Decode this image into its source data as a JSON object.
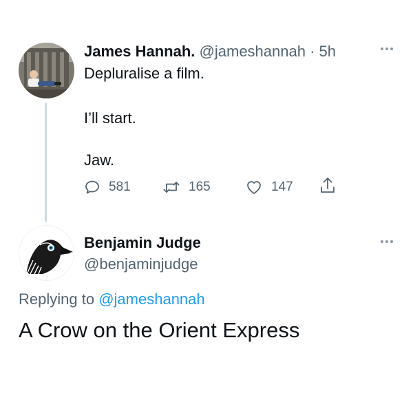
{
  "tweet": {
    "author_name": "James Hannah.",
    "author_handle": "@jameshannah",
    "separator": "·",
    "time": "5h",
    "lines": [
      "Depluralise a film.",
      "I’ll start.",
      "Jaw."
    ],
    "actions": {
      "replies": "581",
      "retweets": "165",
      "likes": "147"
    },
    "avatar_icon": "user-photo-avatar"
  },
  "reply": {
    "author_name": "Benjamin Judge",
    "author_handle": "@benjaminjudge",
    "replying_prefix": "Replying to",
    "replying_handle": "@jameshannah",
    "text": "A Crow on the Orient Express",
    "avatar_icon": "crow-avatar"
  },
  "icons": {
    "reply": "reply-icon",
    "retweet": "retweet-icon",
    "like": "heart-icon",
    "share": "share-icon",
    "more": "more-icon"
  },
  "colors": {
    "text": "#0f1419",
    "muted": "#536471",
    "link": "#1d9bf0",
    "thread_line": "#cfd9de"
  }
}
